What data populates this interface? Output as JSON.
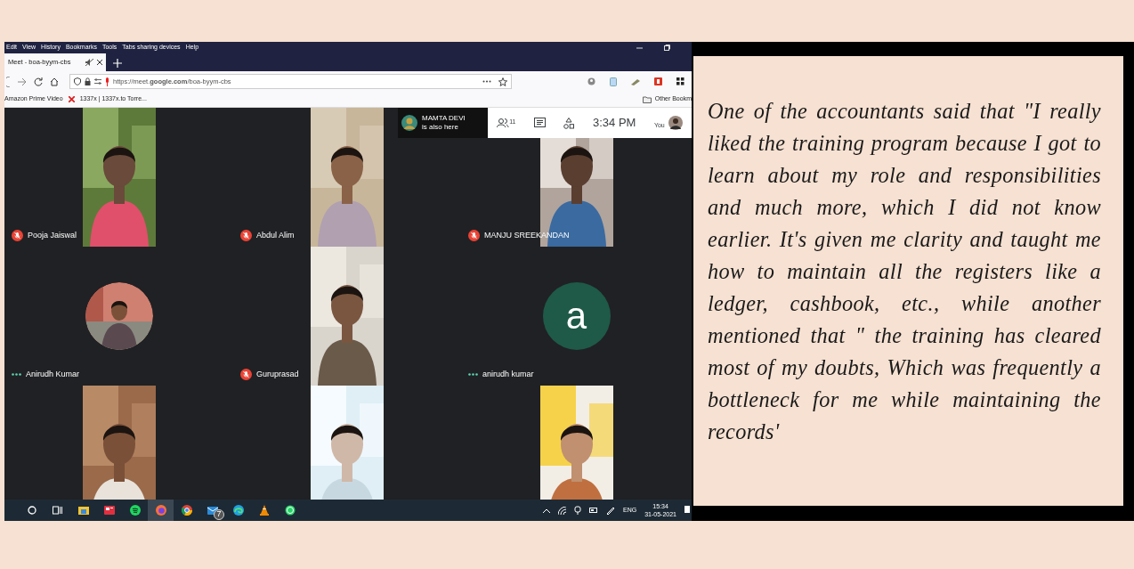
{
  "browser": {
    "menu": [
      "Edit",
      "View",
      "History",
      "Bookmarks",
      "Tools",
      "Tabs sharing devices",
      "Help"
    ],
    "tabs": [
      {
        "title": "Meet - boa-byym-cbs",
        "selected": true
      }
    ],
    "url": "https://meet.**google.com**/boa-byym-cbs",
    "bookmarks": [
      "Amazon Prime Video",
      "1337x | 1337x.to Torre..."
    ],
    "other_bookmarks": "Other Bookm"
  },
  "meet": {
    "tiles": [
      {
        "kind": "video",
        "name": "Pooja Jaiswal",
        "muted": true
      },
      {
        "kind": "video",
        "name": "Abdul Alim",
        "muted": true
      },
      {
        "kind": "video",
        "name": "MANJU SREEKANDAN",
        "muted": true
      },
      {
        "kind": "photo-avatar",
        "name": "Anirudh Kumar",
        "muted": false
      },
      {
        "kind": "video",
        "name": "Guruprasad",
        "muted": true
      },
      {
        "kind": "letter",
        "letter": "a",
        "name": "anirudh kumar",
        "muted": false
      },
      {
        "kind": "video"
      },
      {
        "kind": "video"
      },
      {
        "kind": "video"
      }
    ],
    "notice": {
      "name": "MAMTA DEVI",
      "text": "is also here"
    },
    "participant_count": "11",
    "time": "3:34 PM",
    "self_label": "You"
  },
  "taskbar": {
    "mail_badge": "7",
    "language": "ENG",
    "time": "15:34",
    "date": "31-05-2021"
  },
  "quote": "One of the accountants said that \"I really liked the training program because I got to learn about my role and responsibilities and much more, which I did not know earlier. It's given me clarity and taught me how to maintain all the registers like a ledger, cashbook, etc., while another mentioned that \" the training has cleared most of my doubts, Which was frequently a bottleneck for me while maintaining the records'"
}
